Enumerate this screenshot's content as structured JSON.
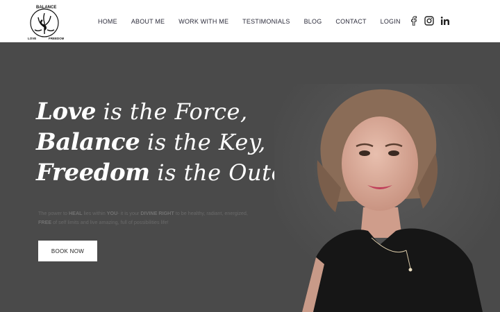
{
  "logo": {
    "text_top": "BALANCE",
    "text_left": "LOVE",
    "text_right": "FREEDOM"
  },
  "nav": {
    "items": [
      {
        "label": "HOME"
      },
      {
        "label": "ABOUT ME"
      },
      {
        "label": "WORK WITH ME"
      },
      {
        "label": "TESTIMONIALS"
      },
      {
        "label": "BLOG"
      },
      {
        "label": "CONTACT"
      },
      {
        "label": "LOGIN"
      }
    ]
  },
  "social": {
    "icons": [
      "facebook-icon",
      "instagram-icon",
      "linkedin-icon"
    ]
  },
  "hero": {
    "line1": {
      "bold": "Love",
      "light": " is the Force,"
    },
    "line2": {
      "bold": "Balance",
      "light": " is the Key,"
    },
    "line3": {
      "bold": "Freedom",
      "light": " is the Outcome."
    },
    "tagline": {
      "p1": "The power to ",
      "b1": "HEAL",
      "p2": " lies within ",
      "b2": "YOU",
      "p3": "- it is your ",
      "b3": "DIVINE RIGHT",
      "p4": " to be healthy, radiant, energized,",
      "b4": "FREE",
      "p5": " of self limits and live amazing, full of possibilities life!"
    },
    "cta": "BOOK NOW"
  },
  "colors": {
    "hero_bg": "#4a4a4a",
    "header_bg": "#ffffff",
    "nav_text": "#2b2b3a"
  }
}
